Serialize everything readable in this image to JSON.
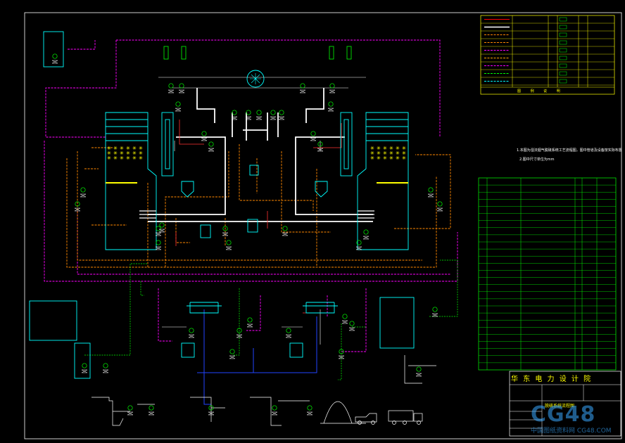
{
  "title_block": {
    "company": "华 东 电 力 设 计 院",
    "drawing_name": "脱硫系统流程图"
  },
  "note": {
    "line1": "1.本图为湿法烟气脱硫系统工艺流程图，图中管道及设备按实际布置",
    "line2": "2.图中尺寸单位为mm"
  },
  "watermark": {
    "big": "CG48",
    "small": "中国图纸资料网 CG48.COM"
  },
  "colors": {
    "flue": "#ffffff",
    "slurry": "#ff8800",
    "water": "#00ffff",
    "air": "#ff00ff",
    "equip": "#00ffff",
    "frame": "#ffff00",
    "table": "#00ff00",
    "magenta": "#ff00ff",
    "red": "#ff3333",
    "blue": "#2244ff"
  },
  "legend_rows": 9,
  "parts_table_rows": 26
}
